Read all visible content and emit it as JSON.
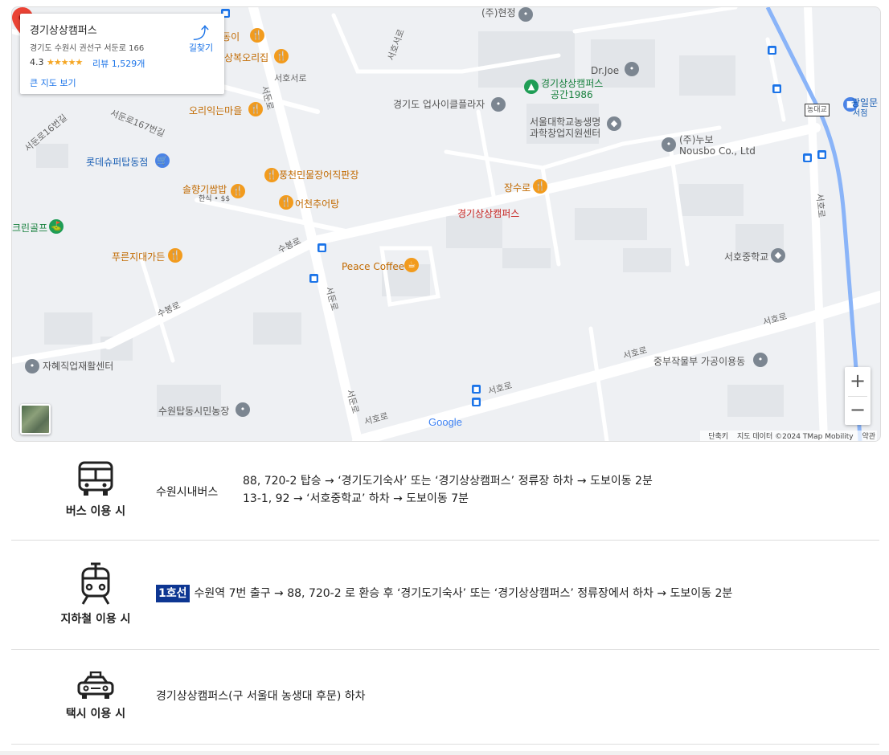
{
  "place_card": {
    "name": "경기상상캠퍼스",
    "address": "경기도 수원시 권선구 서둔로 166",
    "rating": "4.3",
    "stars": "★★★★★",
    "reviews": "리뷰 1,529개",
    "big_map_link": "큰 지도 보기",
    "directions_label": "길찾기"
  },
  "map": {
    "marker_label": "경기상상캠퍼스",
    "labels": {
      "hyeonjeong": "(주)현정",
      "donggi": "돈동이",
      "sangbok": "상복오리집",
      "seohoseoro": "서호서로",
      "orik": "오리익는마을",
      "drjoe": "Dr.Joe",
      "campus_space": "경기상상캠퍼스",
      "campus_space2": "공간1986",
      "upcycle": "경기도 업사이클플라자",
      "snu_center1": "서울대학교농생명",
      "snu_center2": "과학창업지원센터",
      "nousbo1": "(주)누보",
      "nousbo2": "Nousbo Co., Ltd",
      "lotte": "롯데슈퍼탑동점",
      "pungcheon": "풍천민물장어직판장",
      "songhyang": "솔향기쌈밥",
      "songhyang_sub": "한식 • $$",
      "eocheon": "어천추어탕",
      "jangsuro": "장수로",
      "green_golf": "크린골프",
      "pureunji": "푸른지대가든",
      "peace": "Peace Coffee",
      "seoho_middle": "서호중학교",
      "jahye": "자혜직업재활센터",
      "jungbu": "중부작물부 가공이용동",
      "tapdong": "수원탑동시민농장",
      "gwangil1": "광일문",
      "gwangil2": "서점",
      "road_seoho": "서호로",
      "road_subong": "수봉로",
      "road_seodun": "서둔로",
      "road_seoho2": "서호로",
      "road_seodun2": "서둔로",
      "road_seoho3": "서호로",
      "road_seoho4": "서호로",
      "road_167": "서둔로167번길",
      "road_16": "서둔로16번길",
      "road_seoho_v": "서호로",
      "road_subong2": "수봉로",
      "road_seohoseo": "서호서로",
      "nongdaegyo": "농대교"
    },
    "zoom_in": "+",
    "zoom_out": "−",
    "google": "Google",
    "attribution": {
      "shortcuts": "단축키",
      "data": "지도 데이터 ©2024 TMap Mobility",
      "terms": "약관"
    }
  },
  "transit": [
    {
      "mode": "버스 이용 시",
      "icon": "bus-icon",
      "type": "수원시내버스",
      "lines": [
        "88, 720-2 탑승 → ‘경기도기숙사’ 또는 ‘경기상상캠퍼스’ 정류장 하차 → 도보이동 2분",
        "13-1, 92 → ‘서호중학교’ 하차 → 도보이동 7분"
      ]
    },
    {
      "mode": "지하철 이용 시",
      "icon": "subway-icon",
      "badge": "1호선",
      "badge_color": "#0d3692",
      "lines": [
        "수원역 7번 출구 → 88, 720-2 로 환승 후 ‘경기도기숙사’ 또는 ‘경기상상캠퍼스’ 정류장에서 하차 → 도보이동 2분"
      ]
    },
    {
      "mode": "택시 이용 시",
      "icon": "taxi-icon",
      "lines": [
        "경기상상캠퍼스(구 서울대 농생대 후문) 하차"
      ]
    }
  ]
}
